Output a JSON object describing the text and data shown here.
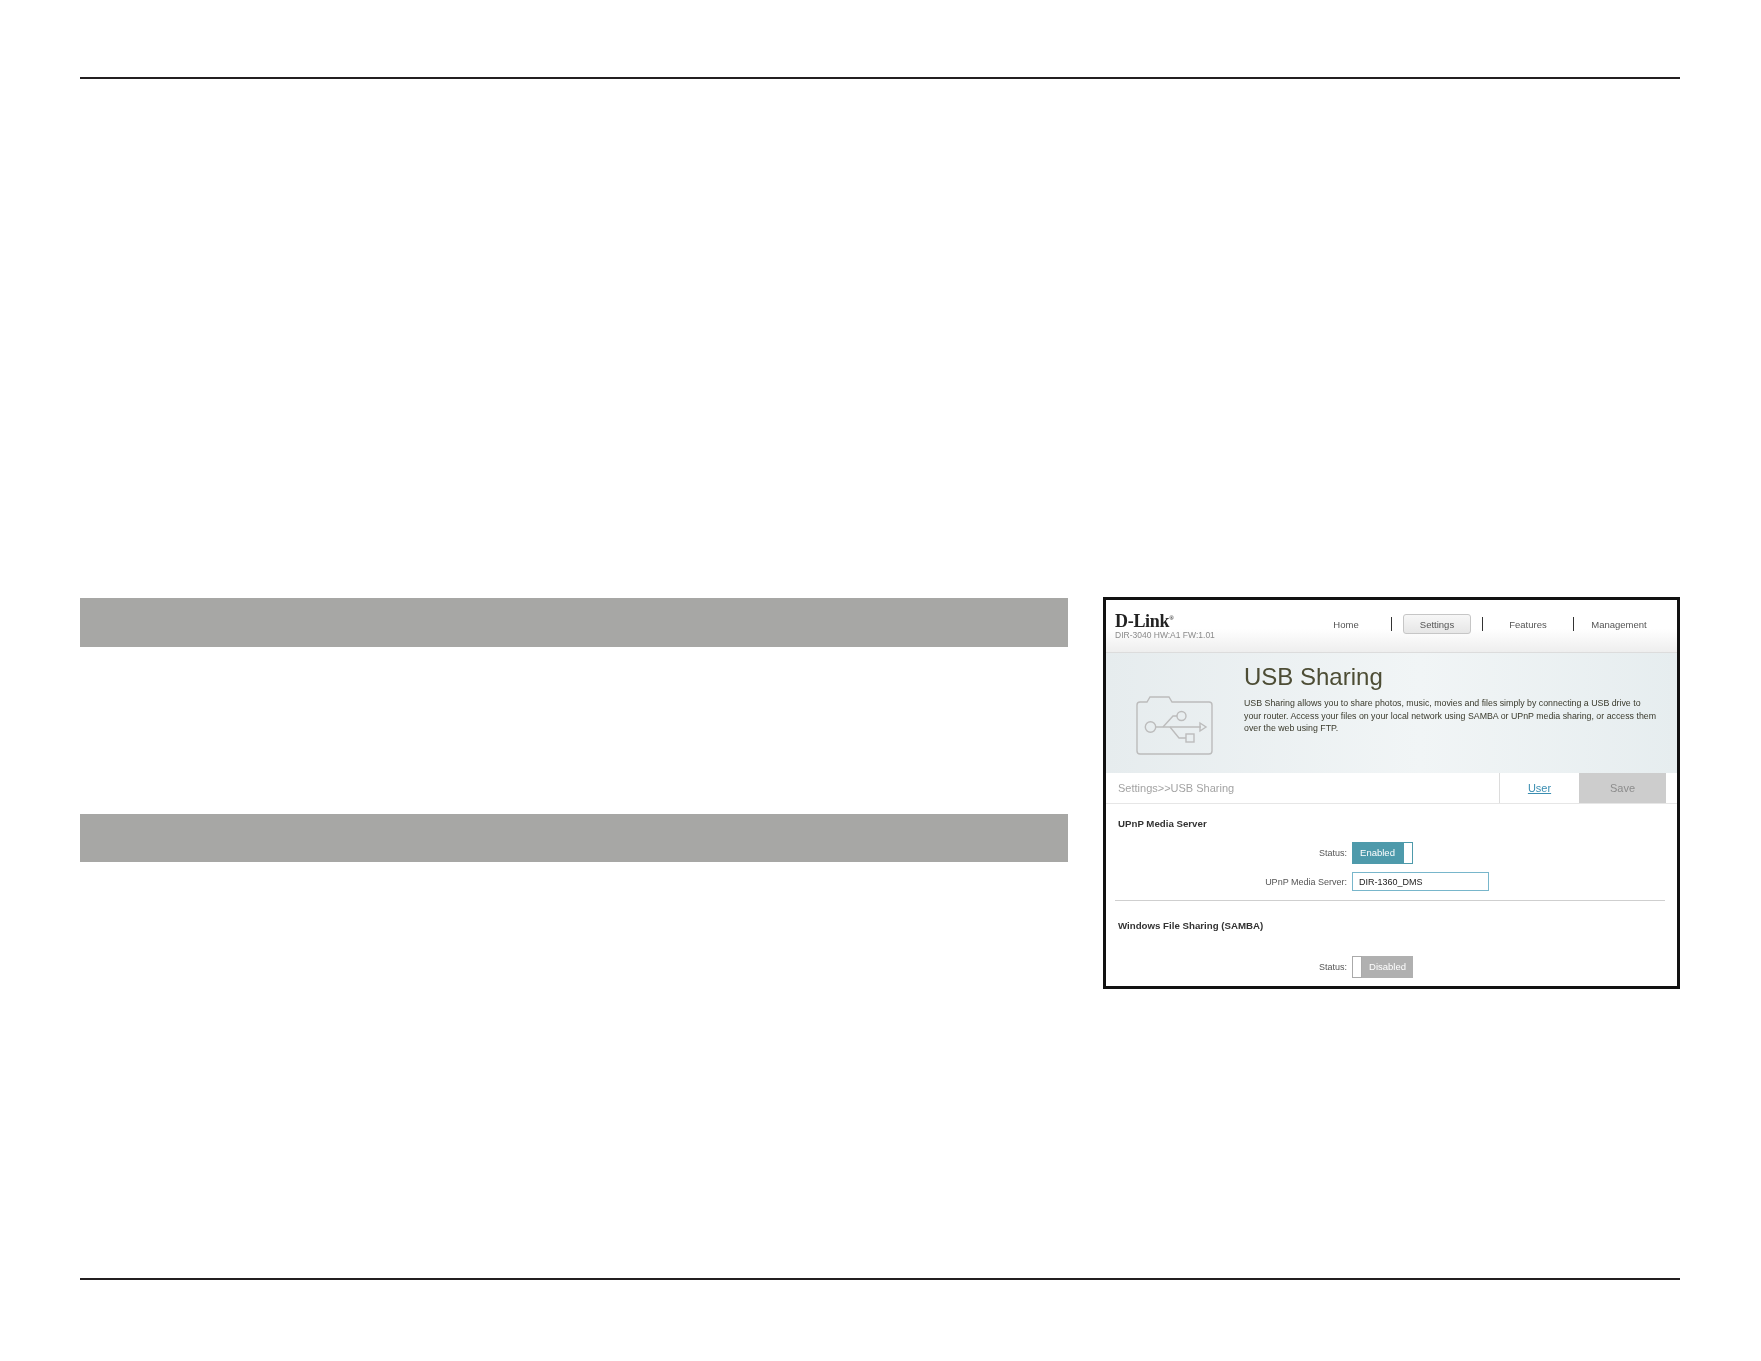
{
  "screenshot": {
    "brand": {
      "logo": "D-Link$^{®}$",
      "model": "DIR-3040 HW:A1 FW:1.01"
    },
    "nav": [
      {
        "label": "Home",
        "selected": false
      },
      {
        "label": "Settings",
        "selected": true
      },
      {
        "label": "Features",
        "selected": false
      },
      {
        "label": "Management",
        "selected": false
      }
    ],
    "hero": {
      "title": "USB Sharing",
      "description": "USB Sharing allows you to share photos, music, movies and files simply by connecting a USB drive to your router. Access your files on your local network using SAMBA or UPnP media sharing, or access them over the web using FTP."
    },
    "breadcrumb": "Settings>>USB Sharing",
    "actions": [
      {
        "kind": "link",
        "label": "User"
      },
      {
        "kind": "button",
        "label": "Save",
        "disabled": true
      }
    ],
    "sections": [
      {
        "title": "UPnP Media Server",
        "fields": [
          {
            "kind": "toggle",
            "label": "Status:",
            "on": true,
            "state_text": "Enabled"
          },
          {
            "kind": "text",
            "label": "UPnP Media Server:",
            "value": "DIR-1360_DMS"
          }
        ]
      },
      {
        "title": "Windows File Sharing (SAMBA)",
        "fields": [
          {
            "kind": "toggle",
            "label": "Status:",
            "on": false,
            "state_text": "Disabled"
          }
        ]
      }
    ]
  }
}
